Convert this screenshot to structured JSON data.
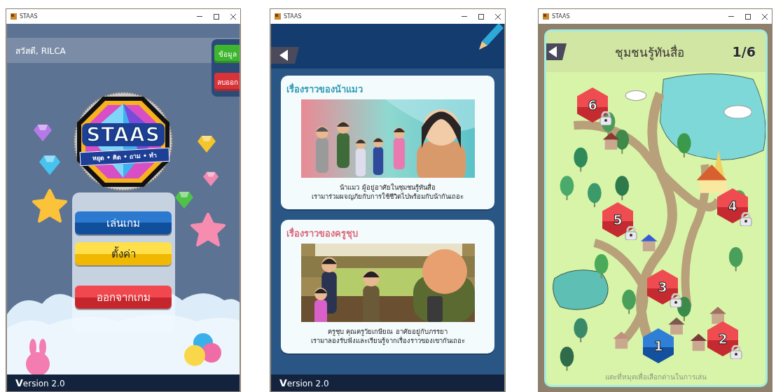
{
  "menu_window": {
    "title": "STAAS",
    "greeting": "สวัสดี, RILCA",
    "side_buttons": [
      {
        "label": "ข้อมูล",
        "kind": "info"
      },
      {
        "label": "ลบออก",
        "kind": "delete"
      }
    ],
    "logo": {
      "title": "STAAS",
      "tagline": "หยุด • คิด • ถาม • ทำ"
    },
    "menu_buttons": [
      {
        "label": "เล่นเกม",
        "kind": "play"
      },
      {
        "label": "ตั้งค่า",
        "kind": "settings"
      },
      {
        "label": "ออกจากเกม",
        "kind": "exit"
      }
    ],
    "version": "**V**ersion 2.0"
  },
  "story_window": {
    "title": "STAAS",
    "stories": [
      {
        "title": "เรื่องราวของน้าแมว",
        "color": "#2f9bb3",
        "caption": [
          "น้าแมว ผู้อยู่อาศัยในชุมชนรู้ทันสื่อ",
          "เรามาร่วมผจญภัยกับการใช้ชีวิตไปพร้อมกับน้ากันเถอะ"
        ]
      },
      {
        "title": "เรื่องราวของครูชุบ",
        "color": "#d9697a",
        "caption": [
          "ครูชุบ คุณครูวัยเกษียณ อาศัยอยู่กับภรรยา",
          "เรามาลองรับฟังและเรียนรู้จากเรื่องราวของเขากันเถอะ"
        ]
      }
    ],
    "version": "**V**ersion 2.0"
  },
  "map_window": {
    "title": "STAAS",
    "heading": "ชุมชนรู้ทันสื่อ",
    "progress": "1/6",
    "levels": [
      {
        "label": "6",
        "locked": true
      },
      {
        "label": "5",
        "locked": true
      },
      {
        "label": "4",
        "locked": true
      },
      {
        "label": "3",
        "locked": true
      },
      {
        "label": "2",
        "locked": true
      },
      {
        "label": "1",
        "locked": false
      }
    ],
    "hint": "แตะที่หมุดเพื่อเลือกด่านในการเล่น"
  }
}
